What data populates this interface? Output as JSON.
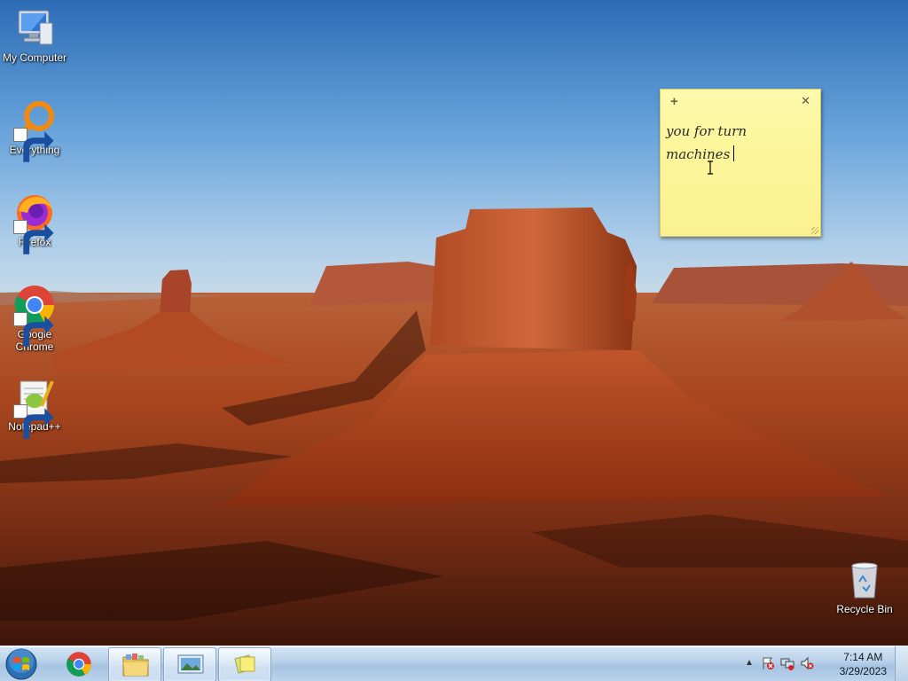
{
  "desktop": {
    "icons": [
      {
        "label": "My Computer",
        "icon": "computer-icon"
      },
      {
        "label": "Everything",
        "icon": "everything-search-icon"
      },
      {
        "label": "Firefox",
        "icon": "firefox-icon"
      },
      {
        "label": "Google Chrome",
        "icon": "chrome-icon"
      },
      {
        "label": "Notepad++",
        "icon": "notepadpp-icon"
      },
      {
        "label": "Recycle Bin",
        "icon": "recycle-bin-icon"
      }
    ]
  },
  "sticky_note": {
    "new_note_glyph": "+",
    "close_glyph": "✕",
    "lines": [
      "you for turn",
      "machines"
    ]
  },
  "taskbar": {
    "start_icon": "windows-start-icon",
    "pinned": [
      "chrome-icon",
      "explorer-folder-icon",
      "photo-viewer-icon",
      "sticky-notes-icon"
    ],
    "tray_show_hidden": "▲",
    "time": "7:14 AM",
    "date": "3/29/2023"
  },
  "colors": {
    "sticky_bg": "#fcf59a",
    "taskbar_top": "#d5e6f5",
    "taskbar_bottom": "#a6c3e2"
  }
}
